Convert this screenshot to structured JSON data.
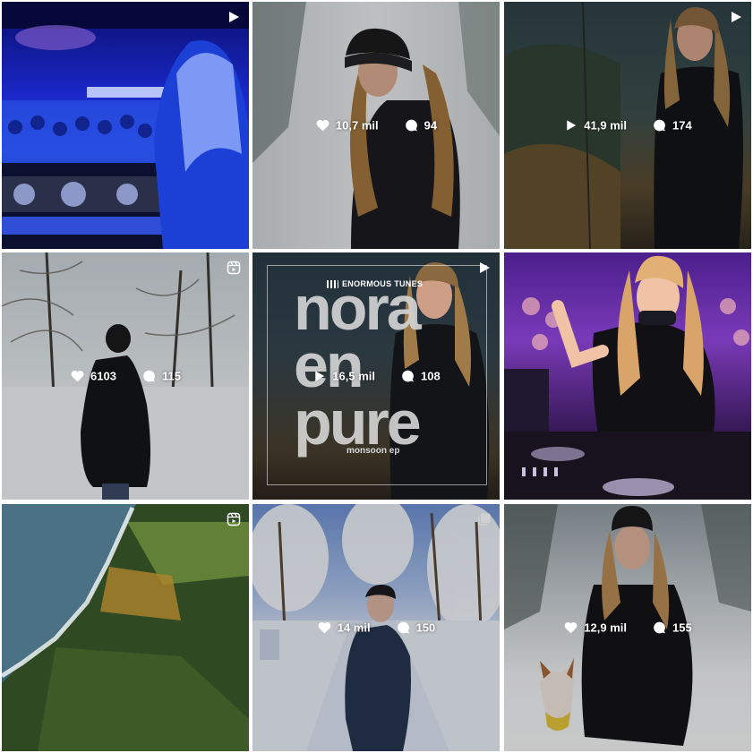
{
  "tiles": [
    {
      "id": "post-1",
      "type": "video",
      "likes": "",
      "comments": ""
    },
    {
      "id": "post-2",
      "type": "image",
      "likes": "10,7 mil",
      "comments": "94"
    },
    {
      "id": "post-3",
      "type": "video",
      "likes": "41,9 mil",
      "comments": "174",
      "likes_icon": "play-icon"
    },
    {
      "id": "post-4",
      "type": "reel",
      "likes": "6103",
      "comments": "115"
    },
    {
      "id": "post-5",
      "type": "video",
      "likes": "16,5 mil",
      "comments": "108",
      "likes_icon": "play-icon",
      "album": {
        "label": "ENORMOUS TUNES",
        "line1": "nora",
        "line2": "en",
        "line3": "pure",
        "subtitle": "monsoon ep"
      }
    },
    {
      "id": "post-6",
      "type": "image",
      "likes": "",
      "comments": ""
    },
    {
      "id": "post-7",
      "type": "reel",
      "likes": "",
      "comments": ""
    },
    {
      "id": "post-8",
      "type": "image",
      "likes": "14 mil",
      "comments": "150"
    },
    {
      "id": "post-9",
      "type": "image",
      "likes": "12,9 mil",
      "comments": "155"
    }
  ],
  "colors": {
    "stat_text": "#ffffff",
    "background": "#ffffff"
  }
}
